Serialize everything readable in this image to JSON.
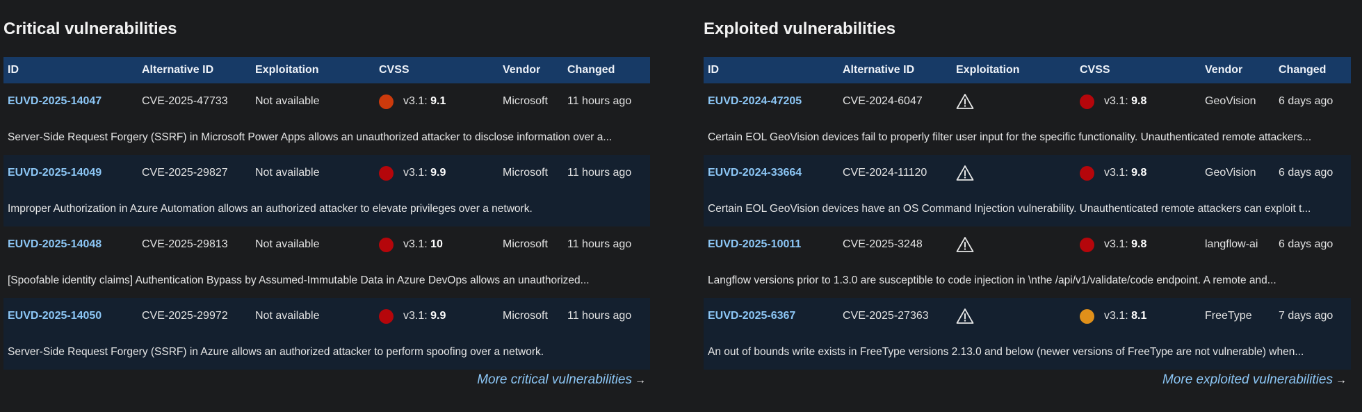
{
  "colors": {
    "header_bg": "#173a66",
    "link": "#8cc6f5",
    "critical_dot": "#b5060b",
    "high_dot": "#cc4a0a",
    "medium_dot": "#e0901a"
  },
  "columns": {
    "id": "ID",
    "alt_id": "Alternative ID",
    "exploitation": "Exploitation",
    "cvss": "CVSS",
    "vendor": "Vendor",
    "changed": "Changed"
  },
  "critical": {
    "title": "Critical vulnerabilities",
    "more_link": "More critical vulnerabilities",
    "rows": [
      {
        "id": "EUVD-2025-14047",
        "alt_id": "CVE-2025-47733",
        "exploitation": "Not available",
        "cvss_prefix": "v3.1: ",
        "cvss_score": "9.1",
        "dot_color": "#cc3a0c",
        "vendor": "Microsoft",
        "changed": "11 hours ago",
        "description": "Server-Side Request Forgery (SSRF) in Microsoft Power Apps allows an unauthorized attacker to disclose information over a..."
      },
      {
        "id": "EUVD-2025-14049",
        "alt_id": "CVE-2025-29827",
        "exploitation": "Not available",
        "cvss_prefix": "v3.1: ",
        "cvss_score": "9.9",
        "dot_color": "#b5060b",
        "vendor": "Microsoft",
        "changed": "11 hours ago",
        "description": "Improper Authorization in Azure Automation allows an authorized attacker to elevate privileges over a network."
      },
      {
        "id": "EUVD-2025-14048",
        "alt_id": "CVE-2025-29813",
        "exploitation": "Not available",
        "cvss_prefix": "v3.1: ",
        "cvss_score": "10",
        "dot_color": "#b5060b",
        "vendor": "Microsoft",
        "changed": "11 hours ago",
        "description": "[Spoofable identity claims] Authentication Bypass by Assumed-Immutable Data in Azure DevOps allows an unauthorized..."
      },
      {
        "id": "EUVD-2025-14050",
        "alt_id": "CVE-2025-29972",
        "exploitation": "Not available",
        "cvss_prefix": "v3.1: ",
        "cvss_score": "9.9",
        "dot_color": "#b5060b",
        "vendor": "Microsoft",
        "changed": "11 hours ago",
        "description": "Server-Side Request Forgery (SSRF) in Azure allows an authorized attacker to perform spoofing over a network."
      }
    ]
  },
  "exploited": {
    "title": "Exploited vulnerabilities",
    "more_link": "More exploited vulnerabilities",
    "exploitation_icon": "warning-triangle-icon",
    "rows": [
      {
        "id": "EUVD-2024-47205",
        "alt_id": "CVE-2024-6047",
        "cvss_prefix": "v3.1: ",
        "cvss_score": "9.8",
        "dot_color": "#b5060b",
        "vendor": "GeoVision",
        "changed": "6 days ago",
        "description": "Certain EOL GeoVision devices fail to properly filter user input for the specific functionality. Unauthenticated remote attackers..."
      },
      {
        "id": "EUVD-2024-33664",
        "alt_id": "CVE-2024-11120",
        "cvss_prefix": "v3.1: ",
        "cvss_score": "9.8",
        "dot_color": "#b5060b",
        "vendor": "GeoVision",
        "changed": "6 days ago",
        "description": "Certain EOL GeoVision devices have an OS Command Injection vulnerability. Unauthenticated remote attackers can exploit t..."
      },
      {
        "id": "EUVD-2025-10011",
        "alt_id": "CVE-2025-3248",
        "cvss_prefix": "v3.1: ",
        "cvss_score": "9.8",
        "dot_color": "#b5060b",
        "vendor": "langflow-ai",
        "changed": "6 days ago",
        "description": "Langflow versions prior to 1.3.0 are susceptible to code injection in \\nthe /api/v1/validate/code endpoint. A remote and..."
      },
      {
        "id": "EUVD-2025-6367",
        "alt_id": "CVE-2025-27363",
        "cvss_prefix": "v3.1: ",
        "cvss_score": "8.1",
        "dot_color": "#e0901a",
        "vendor": "FreeType",
        "changed": "7 days ago",
        "description": "An out of bounds write exists in FreeType versions 2.13.0 and below (newer versions of FreeType are not vulnerable) when..."
      }
    ]
  }
}
